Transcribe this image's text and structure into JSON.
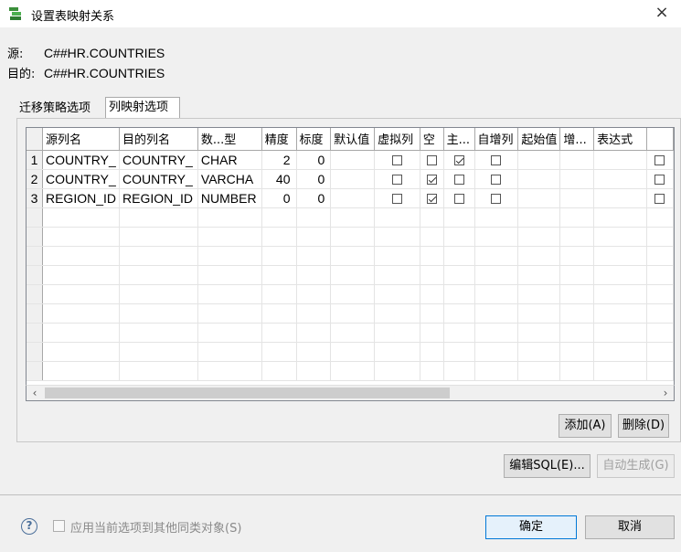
{
  "window": {
    "title": "设置表映射关系",
    "close_label": "×"
  },
  "info": {
    "source_label": "源:",
    "source_value": "C##HR.COUNTRIES",
    "target_label": "目的:",
    "target_value": "C##HR.COUNTRIES"
  },
  "tabs": [
    {
      "label": "迁移策略选项",
      "active": false
    },
    {
      "label": "列映射选项",
      "active": true
    }
  ],
  "table": {
    "columns": [
      "源列名",
      "目的列名",
      "数...型",
      "精度",
      "标度",
      "默认值",
      "虚拟列",
      "空",
      "主...",
      "自增列",
      "起始值",
      "增...",
      "表达式",
      ""
    ],
    "rows": [
      {
        "n": "1",
        "src": "COUNTRY_",
        "dst": "COUNTRY_",
        "type": "CHAR",
        "prec": "2",
        "scale": "0",
        "def": "",
        "virtual": false,
        "nullable": false,
        "pk": true,
        "autoinc": false,
        "start": "",
        "inc": "",
        "expr": "",
        "last": false
      },
      {
        "n": "2",
        "src": "COUNTRY_",
        "dst": "COUNTRY_",
        "type": "VARCHA",
        "prec": "40",
        "scale": "0",
        "def": "",
        "virtual": false,
        "nullable": true,
        "pk": false,
        "autoinc": false,
        "start": "",
        "inc": "",
        "expr": "",
        "last": false
      },
      {
        "n": "3",
        "src": "REGION_ID",
        "dst": "REGION_ID",
        "type": "NUMBER",
        "prec": "0",
        "scale": "0",
        "def": "",
        "virtual": false,
        "nullable": true,
        "pk": false,
        "autoinc": false,
        "start": "",
        "inc": "",
        "expr": "",
        "last": false
      }
    ],
    "empty_rows": 9
  },
  "scroll": {
    "left": "‹",
    "right": "›"
  },
  "buttons": {
    "add": "添加(A)",
    "delete": "删除(D)",
    "edit_sql": "编辑SQL(E)...",
    "auto_generate": "自动生成(G)",
    "ok": "确定",
    "cancel": "取消"
  },
  "footer": {
    "help": "?",
    "apply_label": "应用当前选项到其他同类对象(S)"
  }
}
